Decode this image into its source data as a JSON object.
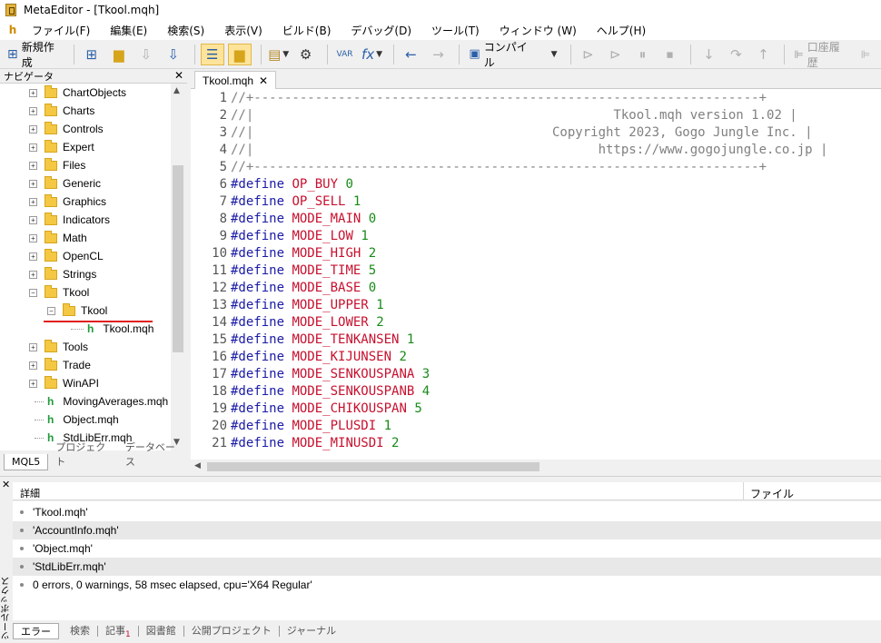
{
  "window": {
    "title": "MetaEditor - [Tkool.mqh]"
  },
  "menu": [
    "ファイル(F)",
    "編集(E)",
    "検索(S)",
    "表示(V)",
    "ビルド(B)",
    "デバッグ(D)",
    "ツール(T)",
    "ウィンドウ (W)",
    "ヘルプ(H)"
  ],
  "toolbar": {
    "new_label": "新規作成",
    "compile_label": "コンパイル",
    "var_label": "VAR",
    "account_label": "口座履歴"
  },
  "navigator": {
    "title": "ナビゲータ",
    "folders": [
      "ChartObjects",
      "Charts",
      "Controls",
      "Expert",
      "Files",
      "Generic",
      "Graphics",
      "Indicators",
      "Math",
      "OpenCL",
      "Strings",
      "Tkool"
    ],
    "sub_folder": "Tkool",
    "sub_file": "Tkool.mqh",
    "folders2": [
      "Tools",
      "Trade",
      "WinAPI"
    ],
    "files": [
      "MovingAverages.mqh",
      "Object.mqh",
      "StdLibErr.mqh"
    ],
    "tabs": [
      "MQL5",
      "プロジェクト",
      "データベース"
    ]
  },
  "editor": {
    "tab": "Tkool.mqh",
    "header_lines": [
      "//+------------------------------------------------------------------+",
      "//|                                               Tkool.mqh version 1.02 |",
      "//|                                       Copyright 2023, Gogo Jungle Inc. |",
      "//|                                             https://www.gogojungle.co.jp |",
      "//+------------------------------------------------------------------+"
    ],
    "defines": [
      {
        "name": "OP_BUY",
        "value": "0"
      },
      {
        "name": "OP_SELL",
        "value": "1"
      },
      {
        "name": "MODE_MAIN",
        "value": "0"
      },
      {
        "name": "MODE_LOW",
        "value": "1"
      },
      {
        "name": "MODE_HIGH",
        "value": "2"
      },
      {
        "name": "MODE_TIME",
        "value": "5"
      },
      {
        "name": "MODE_BASE",
        "value": "0"
      },
      {
        "name": "MODE_UPPER",
        "value": "1"
      },
      {
        "name": "MODE_LOWER",
        "value": "2"
      },
      {
        "name": "MODE_TENKANSEN",
        "value": "1"
      },
      {
        "name": "MODE_KIJUNSEN",
        "value": "2"
      },
      {
        "name": "MODE_SENKOUSPANA",
        "value": "3"
      },
      {
        "name": "MODE_SENKOUSPANB",
        "value": "4"
      },
      {
        "name": "MODE_CHIKOUSPAN",
        "value": "5"
      },
      {
        "name": "MODE_PLUSDI",
        "value": "1"
      },
      {
        "name": "MODE_MINUSDI",
        "value": "2"
      }
    ],
    "define_kw": "#define",
    "line_numbers": [
      "1",
      "2",
      "3",
      "4",
      "5",
      "6",
      "7",
      "8",
      "9",
      "10",
      "11",
      "12",
      "13",
      "14",
      "15",
      "16",
      "17",
      "18",
      "19",
      "20",
      "21"
    ]
  },
  "toolbox": {
    "side_label": "ツールボックス",
    "col_detail": "詳細",
    "col_file": "ファイル",
    "rows": [
      "'Tkool.mqh'",
      "'AccountInfo.mqh'",
      "'Object.mqh'",
      "'StdLibErr.mqh'",
      "0 errors, 0 warnings, 58 msec elapsed, cpu='X64 Regular'"
    ],
    "tabs": [
      "エラー",
      "検索",
      "記事",
      "図書館",
      "公開プロジェクト",
      "ジャーナル"
    ],
    "article_badge": "1"
  }
}
